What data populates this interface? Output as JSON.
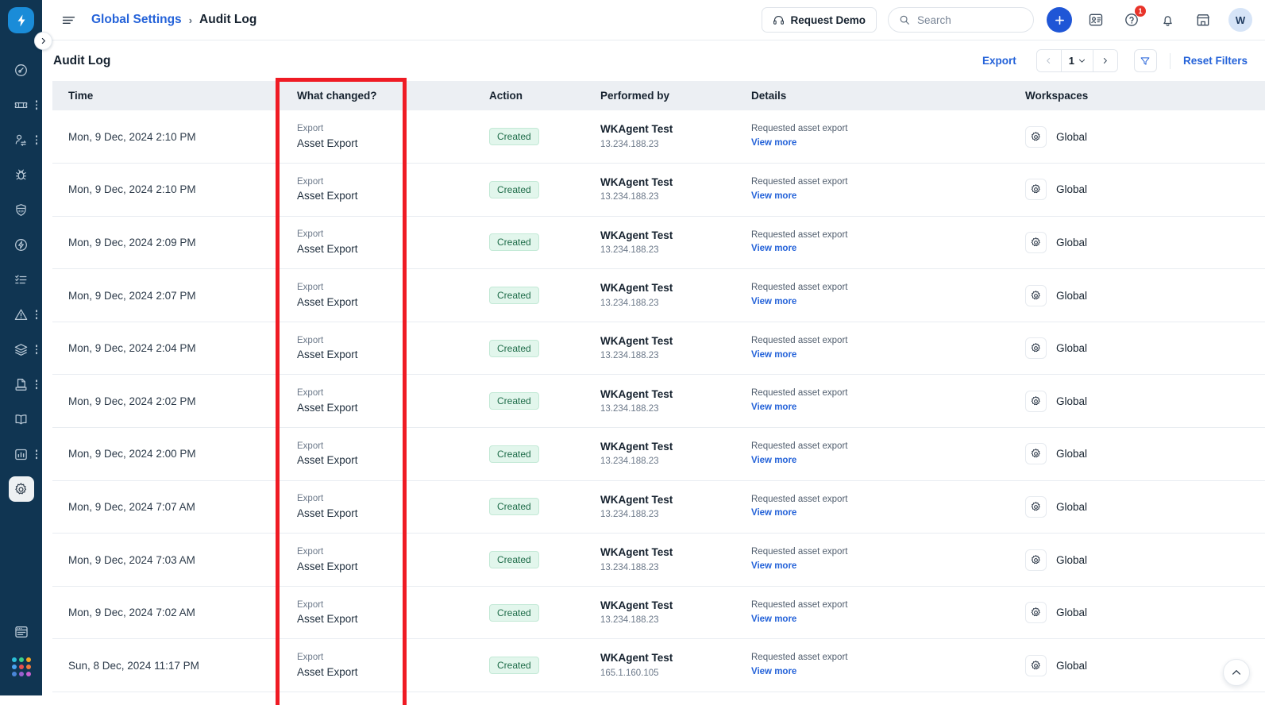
{
  "app": {
    "logo_icon": "lightning-bolt-logo",
    "collapse_icon": "chevron-right-icon"
  },
  "sidebar": {
    "items": [
      {
        "icon": "dashboard-gauge-icon",
        "name": "dashboard",
        "has_menu": false,
        "active": false
      },
      {
        "icon": "ticket-icon",
        "name": "tickets",
        "has_menu": true,
        "active": false
      },
      {
        "icon": "user-swap-icon",
        "name": "user-management",
        "has_menu": true,
        "active": false
      },
      {
        "icon": "bug-icon",
        "name": "problems",
        "has_menu": false,
        "active": false
      },
      {
        "icon": "shield-icon",
        "name": "security",
        "has_menu": false,
        "active": false
      },
      {
        "icon": "lightning-circle-icon",
        "name": "automation",
        "has_menu": false,
        "active": false
      },
      {
        "icon": "checklist-icon",
        "name": "tasks",
        "has_menu": false,
        "active": false
      },
      {
        "icon": "alert-triangle-icon",
        "name": "alerts",
        "has_menu": true,
        "active": false
      },
      {
        "icon": "layers-icon",
        "name": "assets",
        "has_menu": true,
        "active": false
      },
      {
        "icon": "archive-document-icon",
        "name": "contracts",
        "has_menu": true,
        "active": false
      },
      {
        "icon": "book-icon",
        "name": "knowledge-base",
        "has_menu": false,
        "active": false
      },
      {
        "icon": "bar-chart-icon",
        "name": "analytics",
        "has_menu": true,
        "active": false
      },
      {
        "icon": "gear-icon",
        "name": "settings",
        "has_menu": false,
        "active": true
      }
    ],
    "bottom_items": [
      {
        "icon": "browser-window-icon",
        "name": "workspace-switcher"
      },
      {
        "icon": "app-grid-icon",
        "name": "apps-grid"
      }
    ],
    "app_grid_colors": [
      "#2bbfd9",
      "#3bd08a",
      "#f5a623",
      "#4aa3f0",
      "#e8504f",
      "#f07a3c",
      "#4a86d8",
      "#9b5fd0",
      "#c95fd0"
    ]
  },
  "topbar": {
    "hamburger_icon": "hamburger-menu-icon",
    "breadcrumb": {
      "parent": "Global Settings",
      "separator": "›",
      "current": "Audit Log"
    },
    "request_demo": {
      "label": "Request Demo",
      "icon": "headset-icon"
    },
    "search": {
      "placeholder": "Search",
      "icon": "search-icon"
    },
    "add_button_icon": "plus-icon",
    "contacts_icon": "contact-card-icon",
    "help": {
      "icon": "question-circle-icon",
      "badge": "1",
      "badge_color": "#e8342a"
    },
    "notifications_icon": "bell-icon",
    "marketplace_icon": "store-icon",
    "avatar": {
      "initial": "W",
      "name": "user-avatar"
    }
  },
  "page": {
    "title": "Audit Log",
    "export_label": "Export",
    "pagination": {
      "prev_icon": "chevron-left-icon",
      "current_page": "1",
      "caret_icon": "chevron-down-icon",
      "next_icon": "chevron-right-icon"
    },
    "filter_icon": "funnel-filter-icon",
    "reset_filters_label": "Reset Filters",
    "scroll_top_icon": "chevron-up-icon"
  },
  "table": {
    "columns": [
      "Time",
      "What changed?",
      "Action",
      "Performed by",
      "Details",
      "Workspaces"
    ],
    "rows": [
      {
        "time": "Mon, 9 Dec, 2024 2:10 PM",
        "what_sub": "Export",
        "what_main": "Asset Export",
        "action": "Created",
        "performed_by": "WKAgent Test",
        "ip": "13.234.188.23",
        "details": "Requested asset export",
        "details_link": "View more",
        "workspace": "Global",
        "workspace_icon": "gear-icon"
      },
      {
        "time": "Mon, 9 Dec, 2024 2:10 PM",
        "what_sub": "Export",
        "what_main": "Asset Export",
        "action": "Created",
        "performed_by": "WKAgent Test",
        "ip": "13.234.188.23",
        "details": "Requested asset export",
        "details_link": "View more",
        "workspace": "Global",
        "workspace_icon": "gear-icon"
      },
      {
        "time": "Mon, 9 Dec, 2024 2:09 PM",
        "what_sub": "Export",
        "what_main": "Asset Export",
        "action": "Created",
        "performed_by": "WKAgent Test",
        "ip": "13.234.188.23",
        "details": "Requested asset export",
        "details_link": "View more",
        "workspace": "Global",
        "workspace_icon": "gear-icon"
      },
      {
        "time": "Mon, 9 Dec, 2024 2:07 PM",
        "what_sub": "Export",
        "what_main": "Asset Export",
        "action": "Created",
        "performed_by": "WKAgent Test",
        "ip": "13.234.188.23",
        "details": "Requested asset export",
        "details_link": "View more",
        "workspace": "Global",
        "workspace_icon": "gear-icon"
      },
      {
        "time": "Mon, 9 Dec, 2024 2:04 PM",
        "what_sub": "Export",
        "what_main": "Asset Export",
        "action": "Created",
        "performed_by": "WKAgent Test",
        "ip": "13.234.188.23",
        "details": "Requested asset export",
        "details_link": "View more",
        "workspace": "Global",
        "workspace_icon": "gear-icon"
      },
      {
        "time": "Mon, 9 Dec, 2024 2:02 PM",
        "what_sub": "Export",
        "what_main": "Asset Export",
        "action": "Created",
        "performed_by": "WKAgent Test",
        "ip": "13.234.188.23",
        "details": "Requested asset export",
        "details_link": "View more",
        "workspace": "Global",
        "workspace_icon": "gear-icon"
      },
      {
        "time": "Mon, 9 Dec, 2024 2:00 PM",
        "what_sub": "Export",
        "what_main": "Asset Export",
        "action": "Created",
        "performed_by": "WKAgent Test",
        "ip": "13.234.188.23",
        "details": "Requested asset export",
        "details_link": "View more",
        "workspace": "Global",
        "workspace_icon": "gear-icon"
      },
      {
        "time": "Mon, 9 Dec, 2024 7:07 AM",
        "what_sub": "Export",
        "what_main": "Asset Export",
        "action": "Created",
        "performed_by": "WKAgent Test",
        "ip": "13.234.188.23",
        "details": "Requested asset export",
        "details_link": "View more",
        "workspace": "Global",
        "workspace_icon": "gear-icon"
      },
      {
        "time": "Mon, 9 Dec, 2024 7:03 AM",
        "what_sub": "Export",
        "what_main": "Asset Export",
        "action": "Created",
        "performed_by": "WKAgent Test",
        "ip": "13.234.188.23",
        "details": "Requested asset export",
        "details_link": "View more",
        "workspace": "Global",
        "workspace_icon": "gear-icon"
      },
      {
        "time": "Mon, 9 Dec, 2024 7:02 AM",
        "what_sub": "Export",
        "what_main": "Asset Export",
        "action": "Created",
        "performed_by": "WKAgent Test",
        "ip": "13.234.188.23",
        "details": "Requested asset export",
        "details_link": "View more",
        "workspace": "Global",
        "workspace_icon": "gear-icon"
      },
      {
        "time": "Sun, 8 Dec, 2024 11:17 PM",
        "what_sub": "Export",
        "what_main": "Asset Export",
        "action": "Created",
        "performed_by": "WKAgent Test",
        "ip": "165.1.160.105",
        "details": "Requested asset export",
        "details_link": "View more",
        "workspace": "Global",
        "workspace_icon": "gear-icon"
      }
    ]
  },
  "annotation": {
    "highlight_column": "What changed?",
    "color": "#ef1b24"
  }
}
